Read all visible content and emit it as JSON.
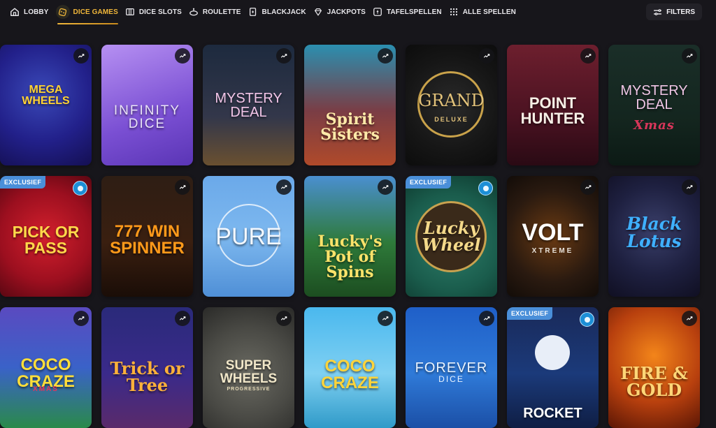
{
  "nav": {
    "items": [
      {
        "label": "LOBBY",
        "icon": "home-icon"
      },
      {
        "label": "DICE GAMES",
        "icon": "dice-icon",
        "active": true
      },
      {
        "label": "DICE SLOTS",
        "icon": "slots-icon"
      },
      {
        "label": "ROULETTE",
        "icon": "roulette-icon"
      },
      {
        "label": "BLACKJACK",
        "icon": "card-icon"
      },
      {
        "label": "JACKPOTS",
        "icon": "diamond-icon"
      },
      {
        "label": "TAFELSPELLEN",
        "icon": "table-games-icon"
      },
      {
        "label": "ALLE SPELLEN",
        "icon": "grid-icon"
      }
    ],
    "filters_label": "FILTERS"
  },
  "colors": {
    "accent": "#f0b63a",
    "background": "#17161b",
    "badge": "#4a8fd9"
  },
  "games": [
    {
      "title": "MEGA WHEELS",
      "row": 0,
      "col": 0
    },
    {
      "title": "INFINITY DICE",
      "row": 0,
      "col": 1
    },
    {
      "title": "MYSTERY DEAL",
      "row": 0,
      "col": 2
    },
    {
      "title": "Spirit Sisters",
      "row": 0,
      "col": 3
    },
    {
      "title": "GRAND",
      "subtitle": "DELUXE",
      "row": 0,
      "col": 4
    },
    {
      "title": "POINT HUNTER",
      "row": 0,
      "col": 5
    },
    {
      "title": "MYSTERY DEAL",
      "subtitle": "Xmas",
      "row": 0,
      "col": 6
    },
    {
      "title": "PICK OR PASS",
      "row": 1,
      "col": 0,
      "badge": "EXCLUSIEF"
    },
    {
      "title": "777 WIN SPINNER",
      "row": 1,
      "col": 1
    },
    {
      "title": "PURE",
      "row": 1,
      "col": 2
    },
    {
      "title": "Lucky's Pot of Spins",
      "row": 1,
      "col": 3
    },
    {
      "title": "Lucky Wheel",
      "row": 1,
      "col": 4,
      "badge": "EXCLUSIEF"
    },
    {
      "title": "VOLT",
      "subtitle": "XTREME",
      "row": 1,
      "col": 5
    },
    {
      "title": "Black Lotus",
      "row": 1,
      "col": 6
    },
    {
      "title": "COCO CRAZE",
      "subtitle": "XMAS",
      "row": 2,
      "col": 0
    },
    {
      "title": "Trick or Tree",
      "row": 2,
      "col": 1
    },
    {
      "title": "SUPER WHEELS",
      "subtitle": "PROGRESSIVE",
      "row": 2,
      "col": 2
    },
    {
      "title": "COCO CRAZE",
      "row": 2,
      "col": 3
    },
    {
      "title": "FOREVER",
      "subtitle": "DICE",
      "row": 2,
      "col": 4
    },
    {
      "title": "ROCKET",
      "row": 2,
      "col": 5,
      "badge": "EXCLUSIEF"
    },
    {
      "title": "FIRE & GOLD",
      "row": 2,
      "col": 6
    }
  ]
}
